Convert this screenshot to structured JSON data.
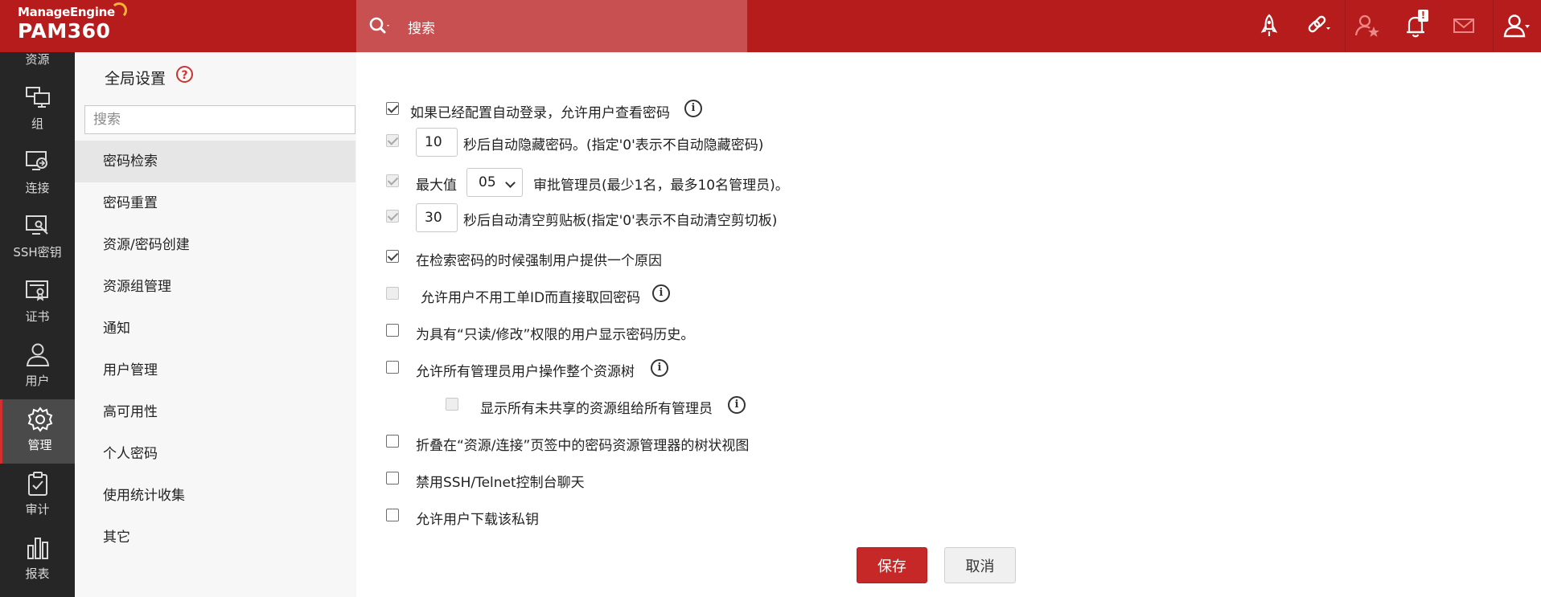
{
  "brand": {
    "company": "ManageEngine",
    "product": "PAM360"
  },
  "search": {
    "placeholder": "搜索"
  },
  "colors": {
    "topbar": "#b71c1c",
    "search_bg": "#c85050",
    "accent": "#c62828",
    "leftnav_bg": "#262626"
  },
  "top_icons": [
    "rocket-icon",
    "link-icon",
    "user-star-icon",
    "bell-icon",
    "mail-icon",
    "user-profile-icon"
  ],
  "notifications": {
    "badge": "!"
  },
  "leftnav": {
    "items": [
      {
        "label": "资源",
        "icon": "resources-icon"
      },
      {
        "label": "组",
        "icon": "group-icon"
      },
      {
        "label": "连接",
        "icon": "connection-icon"
      },
      {
        "label": "SSH密钥",
        "icon": "ssh-key-icon"
      },
      {
        "label": "证书",
        "icon": "certificate-icon"
      },
      {
        "label": "用户",
        "icon": "user-icon"
      },
      {
        "label": "管理",
        "icon": "gear-icon"
      },
      {
        "label": "审计",
        "icon": "audit-icon"
      },
      {
        "label": "报表",
        "icon": "report-icon"
      }
    ],
    "active": "管理"
  },
  "settings_sidebar": {
    "title": "全局设置",
    "help": "?",
    "search_placeholder": "搜索",
    "items": [
      "密码检索",
      "密码重置",
      "资源/密码创建",
      "资源组管理",
      "通知",
      "用户管理",
      "高可用性",
      "个人密码",
      "使用统计收集",
      "其它"
    ],
    "active": "密码检索"
  },
  "options": {
    "auto_logon_view": {
      "label": "如果已经配置自动登录，允许用户查看密码",
      "checked": true
    },
    "auto_hide": {
      "value": "10",
      "label": "秒后自动隐藏密码。(指定'0'表示不自动隐藏密码)",
      "checked": true,
      "disabled": true
    },
    "approvers": {
      "prefix": "最大值",
      "value": "05",
      "label": "审批管理员(最少1名，最多10名管理员)。",
      "checked": true,
      "disabled": true
    },
    "clipboard": {
      "value": "30",
      "label": "秒后自动清空剪贴板(指定'0'表示不自动清空剪切板)",
      "checked": true,
      "disabled": true
    },
    "force_reason": {
      "label": "在检索密码的时候强制用户提供一个原因",
      "checked": true
    },
    "no_ticket": {
      "label": "允许用户不用工单ID而直接取回密码",
      "checked": false,
      "disabled": true
    },
    "show_history": {
      "label": "为具有“只读/修改”权限的用户显示密码历史。",
      "checked": false
    },
    "admin_tree": {
      "label": "允许所有管理员用户操作整个资源树",
      "checked": false
    },
    "show_unshared": {
      "label": "显示所有未共享的资源组给所有管理员",
      "checked": false,
      "disabled": true
    },
    "collapse_tree": {
      "label": "折叠在“资源/连接”页签中的密码资源管理器的树状视图",
      "checked": false
    },
    "disable_chat": {
      "label": "禁用SSH/Telnet控制台聊天",
      "checked": false
    },
    "download_key": {
      "label": "允许用户下载该私钥",
      "checked": false
    }
  },
  "buttons": {
    "save": "保存",
    "cancel": "取消"
  }
}
